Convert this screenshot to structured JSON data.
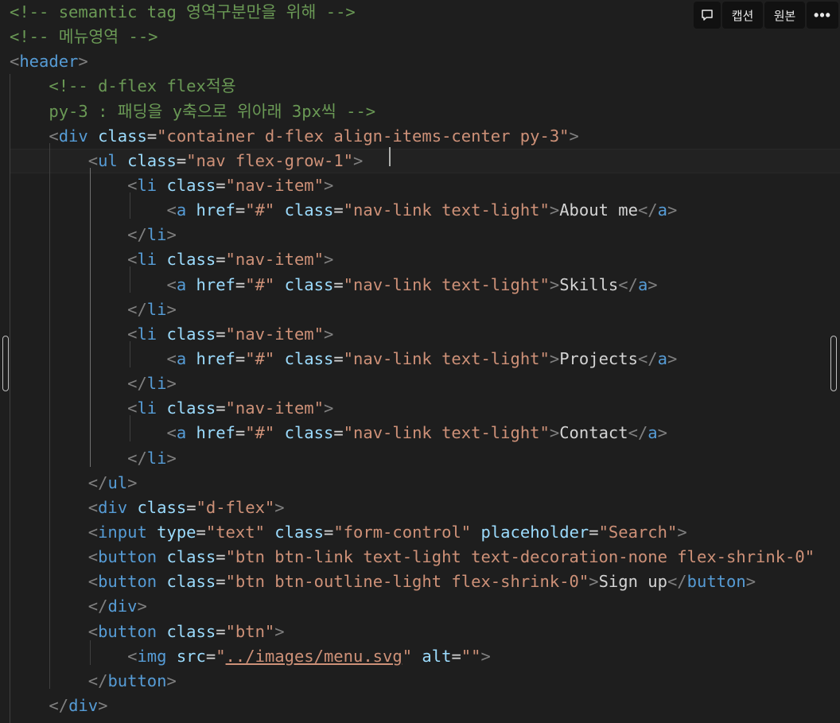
{
  "toolbar": {
    "chat_icon": "speech-bubble-icon",
    "caption_label": "캡션",
    "original_label": "원본",
    "more_label": "•••"
  },
  "editor": {
    "lines": [
      [
        {
          "t": "<!-- semantic tag 영역구분만을 위해 -->",
          "c": "com"
        }
      ],
      [
        {
          "t": "<!-- 메뉴영역 -->",
          "c": "com"
        }
      ],
      [
        {
          "t": "<",
          "c": "pun"
        },
        {
          "t": "header",
          "c": "tag"
        },
        {
          "t": ">",
          "c": "pun"
        }
      ],
      [
        {
          "t": "    "
        },
        {
          "t": "<!-- d-flex flex적용",
          "c": "com"
        }
      ],
      [
        {
          "t": "    "
        },
        {
          "t": "py-3 : 패딩을 y축으로 위아래 3px씩 -->",
          "c": "com"
        }
      ],
      [
        {
          "t": "    "
        },
        {
          "t": "<",
          "c": "pun"
        },
        {
          "t": "div",
          "c": "tag"
        },
        {
          "t": " "
        },
        {
          "t": "class",
          "c": "att"
        },
        {
          "t": "=",
          "c": "eq"
        },
        {
          "t": "\"container d-flex align-items-center py-3\"",
          "c": "str"
        },
        {
          "t": ">",
          "c": "pun"
        }
      ],
      [
        {
          "t": "        "
        },
        {
          "t": "<",
          "c": "pun"
        },
        {
          "t": "ul",
          "c": "tag"
        },
        {
          "t": " "
        },
        {
          "t": "class",
          "c": "att"
        },
        {
          "t": "=",
          "c": "eq"
        },
        {
          "t": "\"nav flex-grow-1\"",
          "c": "str"
        },
        {
          "t": ">",
          "c": "pun"
        }
      ],
      [
        {
          "t": "            "
        },
        {
          "t": "<",
          "c": "pun"
        },
        {
          "t": "li",
          "c": "tag"
        },
        {
          "t": " "
        },
        {
          "t": "class",
          "c": "att"
        },
        {
          "t": "=",
          "c": "eq"
        },
        {
          "t": "\"nav-item\"",
          "c": "str"
        },
        {
          "t": ">",
          "c": "pun"
        }
      ],
      [
        {
          "t": "                "
        },
        {
          "t": "<",
          "c": "pun"
        },
        {
          "t": "a",
          "c": "tag"
        },
        {
          "t": " "
        },
        {
          "t": "href",
          "c": "att"
        },
        {
          "t": "=",
          "c": "eq"
        },
        {
          "t": "\"#\"",
          "c": "str"
        },
        {
          "t": " "
        },
        {
          "t": "class",
          "c": "att"
        },
        {
          "t": "=",
          "c": "eq"
        },
        {
          "t": "\"nav-link text-light\"",
          "c": "str"
        },
        {
          "t": ">",
          "c": "pun"
        },
        {
          "t": "About me",
          "c": "txt"
        },
        {
          "t": "</",
          "c": "pun"
        },
        {
          "t": "a",
          "c": "tag"
        },
        {
          "t": ">",
          "c": "pun"
        }
      ],
      [
        {
          "t": "            "
        },
        {
          "t": "</",
          "c": "pun"
        },
        {
          "t": "li",
          "c": "tag"
        },
        {
          "t": ">",
          "c": "pun"
        }
      ],
      [
        {
          "t": "            "
        },
        {
          "t": "<",
          "c": "pun"
        },
        {
          "t": "li",
          "c": "tag"
        },
        {
          "t": " "
        },
        {
          "t": "class",
          "c": "att"
        },
        {
          "t": "=",
          "c": "eq"
        },
        {
          "t": "\"nav-item\"",
          "c": "str"
        },
        {
          "t": ">",
          "c": "pun"
        }
      ],
      [
        {
          "t": "                "
        },
        {
          "t": "<",
          "c": "pun"
        },
        {
          "t": "a",
          "c": "tag"
        },
        {
          "t": " "
        },
        {
          "t": "href",
          "c": "att"
        },
        {
          "t": "=",
          "c": "eq"
        },
        {
          "t": "\"#\"",
          "c": "str"
        },
        {
          "t": " "
        },
        {
          "t": "class",
          "c": "att"
        },
        {
          "t": "=",
          "c": "eq"
        },
        {
          "t": "\"nav-link text-light\"",
          "c": "str"
        },
        {
          "t": ">",
          "c": "pun"
        },
        {
          "t": "Skills",
          "c": "txt"
        },
        {
          "t": "</",
          "c": "pun"
        },
        {
          "t": "a",
          "c": "tag"
        },
        {
          "t": ">",
          "c": "pun"
        }
      ],
      [
        {
          "t": "            "
        },
        {
          "t": "</",
          "c": "pun"
        },
        {
          "t": "li",
          "c": "tag"
        },
        {
          "t": ">",
          "c": "pun"
        }
      ],
      [
        {
          "t": "            "
        },
        {
          "t": "<",
          "c": "pun"
        },
        {
          "t": "li",
          "c": "tag"
        },
        {
          "t": " "
        },
        {
          "t": "class",
          "c": "att"
        },
        {
          "t": "=",
          "c": "eq"
        },
        {
          "t": "\"nav-item\"",
          "c": "str"
        },
        {
          "t": ">",
          "c": "pun"
        }
      ],
      [
        {
          "t": "                "
        },
        {
          "t": "<",
          "c": "pun"
        },
        {
          "t": "a",
          "c": "tag"
        },
        {
          "t": " "
        },
        {
          "t": "href",
          "c": "att"
        },
        {
          "t": "=",
          "c": "eq"
        },
        {
          "t": "\"#\"",
          "c": "str"
        },
        {
          "t": " "
        },
        {
          "t": "class",
          "c": "att"
        },
        {
          "t": "=",
          "c": "eq"
        },
        {
          "t": "\"nav-link text-light\"",
          "c": "str"
        },
        {
          "t": ">",
          "c": "pun"
        },
        {
          "t": "Projects",
          "c": "txt"
        },
        {
          "t": "</",
          "c": "pun"
        },
        {
          "t": "a",
          "c": "tag"
        },
        {
          "t": ">",
          "c": "pun"
        }
      ],
      [
        {
          "t": "            "
        },
        {
          "t": "</",
          "c": "pun"
        },
        {
          "t": "li",
          "c": "tag"
        },
        {
          "t": ">",
          "c": "pun"
        }
      ],
      [
        {
          "t": "            "
        },
        {
          "t": "<",
          "c": "pun"
        },
        {
          "t": "li",
          "c": "tag"
        },
        {
          "t": " "
        },
        {
          "t": "class",
          "c": "att"
        },
        {
          "t": "=",
          "c": "eq"
        },
        {
          "t": "\"nav-item\"",
          "c": "str"
        },
        {
          "t": ">",
          "c": "pun"
        }
      ],
      [
        {
          "t": "                "
        },
        {
          "t": "<",
          "c": "pun"
        },
        {
          "t": "a",
          "c": "tag"
        },
        {
          "t": " "
        },
        {
          "t": "href",
          "c": "att"
        },
        {
          "t": "=",
          "c": "eq"
        },
        {
          "t": "\"#\"",
          "c": "str"
        },
        {
          "t": " "
        },
        {
          "t": "class",
          "c": "att"
        },
        {
          "t": "=",
          "c": "eq"
        },
        {
          "t": "\"nav-link text-light\"",
          "c": "str"
        },
        {
          "t": ">",
          "c": "pun"
        },
        {
          "t": "Contact",
          "c": "txt"
        },
        {
          "t": "</",
          "c": "pun"
        },
        {
          "t": "a",
          "c": "tag"
        },
        {
          "t": ">",
          "c": "pun"
        }
      ],
      [
        {
          "t": "            "
        },
        {
          "t": "</",
          "c": "pun"
        },
        {
          "t": "li",
          "c": "tag"
        },
        {
          "t": ">",
          "c": "pun"
        }
      ],
      [
        {
          "t": "        "
        },
        {
          "t": "</",
          "c": "pun"
        },
        {
          "t": "ul",
          "c": "tag"
        },
        {
          "t": ">",
          "c": "pun"
        }
      ],
      [
        {
          "t": "        "
        },
        {
          "t": "<",
          "c": "pun"
        },
        {
          "t": "div",
          "c": "tag"
        },
        {
          "t": " "
        },
        {
          "t": "class",
          "c": "att"
        },
        {
          "t": "=",
          "c": "eq"
        },
        {
          "t": "\"d-flex\"",
          "c": "str"
        },
        {
          "t": ">",
          "c": "pun"
        }
      ],
      [
        {
          "t": "        "
        },
        {
          "t": "<",
          "c": "pun"
        },
        {
          "t": "input",
          "c": "tag"
        },
        {
          "t": " "
        },
        {
          "t": "type",
          "c": "att"
        },
        {
          "t": "=",
          "c": "eq"
        },
        {
          "t": "\"text\"",
          "c": "str"
        },
        {
          "t": " "
        },
        {
          "t": "class",
          "c": "att"
        },
        {
          "t": "=",
          "c": "eq"
        },
        {
          "t": "\"form-control\"",
          "c": "str"
        },
        {
          "t": " "
        },
        {
          "t": "placeholder",
          "c": "att"
        },
        {
          "t": "=",
          "c": "eq"
        },
        {
          "t": "\"Search\"",
          "c": "str"
        },
        {
          "t": ">",
          "c": "pun"
        }
      ],
      [
        {
          "t": "        "
        },
        {
          "t": "<",
          "c": "pun"
        },
        {
          "t": "button",
          "c": "tag"
        },
        {
          "t": " "
        },
        {
          "t": "class",
          "c": "att"
        },
        {
          "t": "=",
          "c": "eq"
        },
        {
          "t": "\"btn btn-link text-light text-decoration-none flex-shrink-0\"",
          "c": "str"
        }
      ],
      [
        {
          "t": "        "
        },
        {
          "t": "<",
          "c": "pun"
        },
        {
          "t": "button",
          "c": "tag"
        },
        {
          "t": " "
        },
        {
          "t": "class",
          "c": "att"
        },
        {
          "t": "=",
          "c": "eq"
        },
        {
          "t": "\"btn btn-outline-light flex-shrink-0\"",
          "c": "str"
        },
        {
          "t": ">",
          "c": "pun"
        },
        {
          "t": "Sign up",
          "c": "txt"
        },
        {
          "t": "</",
          "c": "pun"
        },
        {
          "t": "button",
          "c": "tag"
        },
        {
          "t": ">",
          "c": "pun"
        }
      ],
      [
        {
          "t": "        "
        },
        {
          "t": "</",
          "c": "pun"
        },
        {
          "t": "div",
          "c": "tag"
        },
        {
          "t": ">",
          "c": "pun"
        }
      ],
      [
        {
          "t": "        "
        },
        {
          "t": "<",
          "c": "pun"
        },
        {
          "t": "button",
          "c": "tag"
        },
        {
          "t": " "
        },
        {
          "t": "class",
          "c": "att"
        },
        {
          "t": "=",
          "c": "eq"
        },
        {
          "t": "\"btn\"",
          "c": "str"
        },
        {
          "t": ">",
          "c": "pun"
        }
      ],
      [
        {
          "t": "            "
        },
        {
          "t": "<",
          "c": "pun"
        },
        {
          "t": "img",
          "c": "tag"
        },
        {
          "t": " "
        },
        {
          "t": "src",
          "c": "att"
        },
        {
          "t": "=",
          "c": "eq"
        },
        {
          "t": "\"",
          "c": "str"
        },
        {
          "t": "../images/menu.svg",
          "c": "str link"
        },
        {
          "t": "\"",
          "c": "str"
        },
        {
          "t": " "
        },
        {
          "t": "alt",
          "c": "att"
        },
        {
          "t": "=",
          "c": "eq"
        },
        {
          "t": "\"\"",
          "c": "str"
        },
        {
          "t": ">",
          "c": "pun"
        }
      ],
      [
        {
          "t": "        "
        },
        {
          "t": "</",
          "c": "pun"
        },
        {
          "t": "button",
          "c": "tag"
        },
        {
          "t": ">",
          "c": "pun"
        }
      ],
      [
        {
          "t": "    "
        },
        {
          "t": "</",
          "c": "pun"
        },
        {
          "t": "div",
          "c": "tag"
        },
        {
          "t": ">",
          "c": "pun"
        }
      ]
    ]
  }
}
